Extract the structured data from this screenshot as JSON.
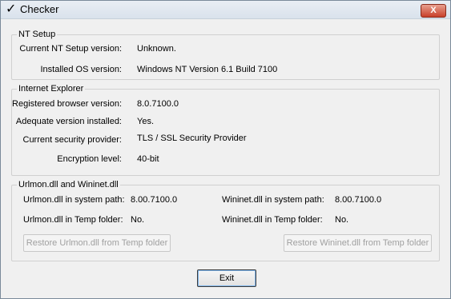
{
  "window": {
    "title": "Checker",
    "title_icon": "checkmark-icon",
    "close_label": "X"
  },
  "nt_setup": {
    "legend": "NT Setup",
    "rows": [
      {
        "label": "Current NT Setup version:",
        "value": "Unknown."
      },
      {
        "label": "Installed OS version:",
        "value": "Windows NT Version 6.1 Build 7100"
      }
    ]
  },
  "ie": {
    "legend": "Internet Explorer",
    "rows": [
      {
        "label": "Registered browser version:",
        "value": "8.0.7100.0"
      },
      {
        "label": "Adequate version installed:",
        "value": "Yes."
      },
      {
        "label": "Current security provider:",
        "value": "TLS / SSL Security Provider"
      },
      {
        "label": "Encryption level:",
        "value": "40-bit"
      }
    ]
  },
  "urlmon": {
    "legend": "Urlmon.dll and Wininet.dll",
    "urlmon_path_label": "Urlmon.dll in system path:",
    "urlmon_path_value": "8.00.7100.0",
    "urlmon_temp_label": "Urlmon.dll in Temp folder:",
    "urlmon_temp_value": "No.",
    "wininet_path_label": "Wininet.dll in system path:",
    "wininet_path_value": "8.00.7100.0",
    "wininet_temp_label": "Wininet.dll in Temp folder:",
    "wininet_temp_value": "No.",
    "restore_urlmon_label": "Restore Urlmon.dll from Temp folder",
    "restore_wininet_label": "Restore Wininet.dll from Temp folder"
  },
  "exit_label": "Exit"
}
